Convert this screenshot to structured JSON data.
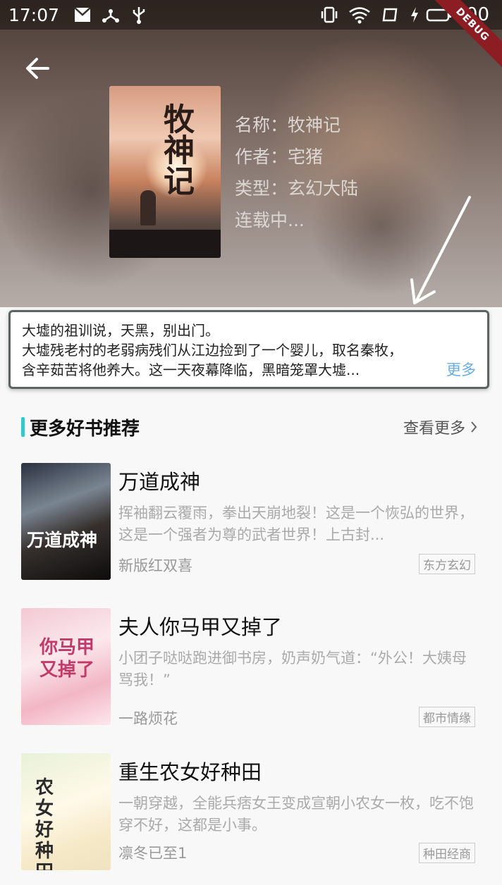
{
  "status_bar": {
    "time": "17:07",
    "battery": "100",
    "debug_label": "DEBUG"
  },
  "book": {
    "cover_title": "牧神记",
    "name_line": "名称：牧神记",
    "author_line": "作者：宅猪",
    "type_line": "类型：玄幻大陆",
    "status_line": "连载中..."
  },
  "description": {
    "line1": "大墟的祖训说，天黑，别出门。",
    "line2": "大墟残老村的老弱病残们从江边捡到了一个婴儿，取名秦牧，",
    "line3": "含辛茹苦将他养大。这一天夜幕降临，黑暗笼罩大墟...",
    "more_label": "更多"
  },
  "recommend": {
    "title": "更多好书推荐",
    "see_more": "查看更多",
    "books": [
      {
        "title": "万道成神",
        "summary": "挥袖翻云覆雨，拳出天崩地裂！这是一个恢弘的世界，这是一个强者为尊的武者世界！上古封...",
        "author": "新版红双喜",
        "tag": "东方玄幻",
        "cover_text": "万道成神"
      },
      {
        "title": "夫人你马甲又掉了",
        "summary": "小团子哒哒跑进御书房，奶声奶气道：“外公！大姨母骂我！”",
        "author": "一路烦花",
        "tag": "都市情缘",
        "cover_text": "你马甲又掉了"
      },
      {
        "title": "重生农女好种田",
        "summary": "一朝穿越，全能兵痞女王变成宣朝小农女一枚，吃不饱穿不好，这都是小事。",
        "author": "凛冬已至1",
        "tag": "种田经商",
        "cover_text": "农女好种田"
      }
    ]
  },
  "colors": {
    "accent": "#3bc5c9",
    "link": "#6aaee0",
    "debug": "#8c1d22"
  }
}
